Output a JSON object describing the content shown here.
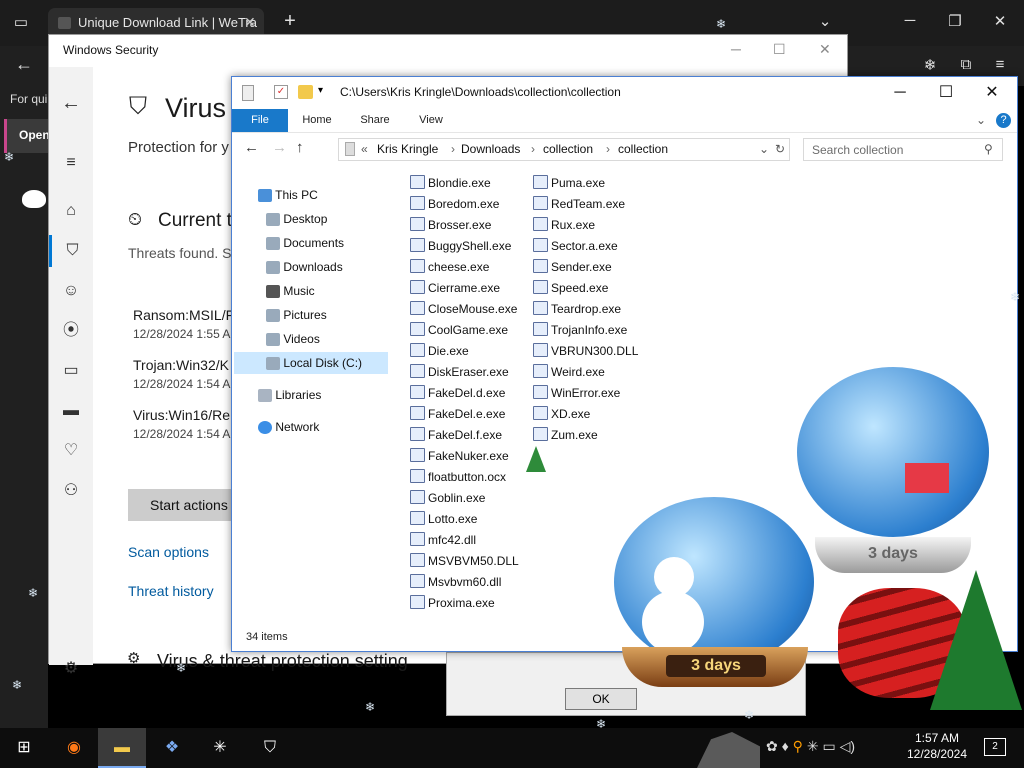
{
  "browser": {
    "tab_title": "Unique Download Link | WeTra",
    "new_tab_symbol": "+",
    "sidebar_text_1": "For qui",
    "sidebar_text_2": "Open"
  },
  "winsec": {
    "title": "Windows Security",
    "heading": "Virus",
    "subheading": "Protection for y",
    "current_heading": "Current t",
    "threats_text": "Threats found. S",
    "threats": [
      {
        "name": "Ransom:MSIL/F",
        "date": "12/28/2024 1:55 A"
      },
      {
        "name": "Trojan:Win32/K",
        "date": "12/28/2024 1:54 A"
      },
      {
        "name": "Virus:Win16/Re",
        "date": "12/28/2024 1:54 A"
      }
    ],
    "start_actions": "Start actions",
    "scan_options": "Scan options",
    "threat_history": "Threat history",
    "settings_heading": "Virus & threat protection setting"
  },
  "explorer": {
    "path": "C:\\Users\\Kris Kringle\\Downloads\\collection\\collection",
    "ribbon_tabs": [
      "File",
      "Home",
      "Share",
      "View"
    ],
    "breadcrumb": [
      "Kris Kringle",
      "Downloads",
      "collection",
      "collection"
    ],
    "search_placeholder": "Search collection",
    "status": "34 items",
    "tree": {
      "this_pc": "This PC",
      "desktop": "Desktop",
      "documents": "Documents",
      "downloads": "Downloads",
      "music": "Music",
      "pictures": "Pictures",
      "videos": "Videos",
      "local_disk": "Local Disk (C:)",
      "libraries": "Libraries",
      "network": "Network"
    },
    "files_col1": [
      "Blondie.exe",
      "Boredom.exe",
      "Brosser.exe",
      "BuggyShell.exe",
      "cheese.exe",
      "Cierrame.exe",
      "CloseMouse.exe",
      "CoolGame.exe",
      "Die.exe",
      "DiskEraser.exe",
      "FakeDel.d.exe",
      "FakeDel.e.exe",
      "FakeDel.f.exe",
      "FakeNuker.exe",
      "floatbutton.ocx",
      "Goblin.exe",
      "Lotto.exe",
      "mfc42.dll",
      "MSVBVM50.DLL",
      "Msvbvm60.dll",
      "Proxima.exe"
    ],
    "files_col2": [
      "Puma.exe",
      "RedTeam.exe",
      "Rux.exe",
      "Sector.a.exe",
      "Sender.exe",
      "Speed.exe",
      "Teardrop.exe",
      "TrojanInfo.exe",
      "VBRUN300.DLL",
      "Weird.exe",
      "WinError.exe",
      "XD.exe",
      "Zum.exe"
    ]
  },
  "dialog": {
    "ok": "OK"
  },
  "globes": {
    "label_1": "3 days",
    "label_2": "3 days"
  },
  "taskbar": {
    "time": "1:57 AM",
    "date": "12/28/2024",
    "notifications": "2"
  }
}
